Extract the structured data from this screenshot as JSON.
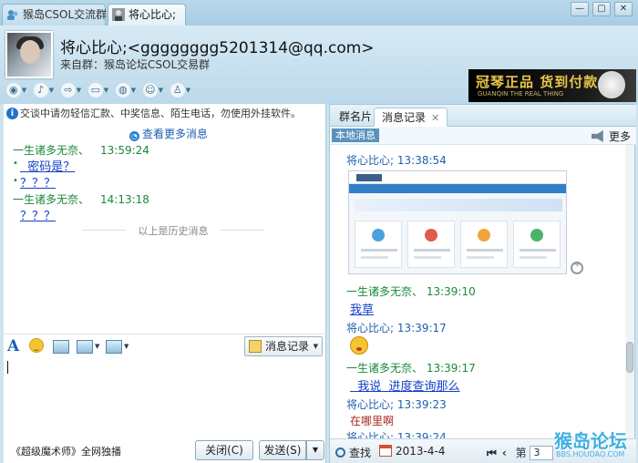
{
  "tabs": [
    {
      "label": "猴岛CSOL交流群",
      "active": false
    },
    {
      "label": "将心比心;",
      "active": true
    }
  ],
  "header": {
    "nick_email": "将心比心;<gggggggg5201314@qq.com>",
    "from_group": "来自群：猴岛论坛CSOL交易群",
    "ad_main": "冠琴正品 货到付款",
    "ad_sub": "GUANQIN THE REAL THING"
  },
  "left": {
    "notice": "交谈中请勿轻信汇款、中奖信息、陌生电话，勿使用外挂软件。",
    "more_link": "查看更多消息",
    "messages": [
      {
        "sender": "一生诸多无奈、",
        "time": "13:59:24",
        "body": "  密码是？"
      },
      {
        "body": "？？？"
      },
      {
        "sender": "一生诸多无奈、",
        "time": "14:13:18",
        "body": "？？？"
      }
    ],
    "history_divider": "以上是历史消息",
    "history_button": "消息记录",
    "promo": "《超级魔术师》全网独播",
    "close_button": "关闭(C)",
    "send_button": "发送(S)"
  },
  "right": {
    "tab_card": "群名片",
    "tab_history": "消息记录",
    "local_tag": "本地消息",
    "more": "更多",
    "messages": [
      {
        "sender": "将心比心;",
        "time": "13:38:54",
        "color": "blue"
      },
      {
        "sender": "一生诸多无奈、",
        "time": "13:39:10",
        "color": "green",
        "body": "我草"
      },
      {
        "sender": "将心比心;",
        "time": "13:39:17",
        "color": "blue"
      },
      {
        "sender": "一生诸多无奈、",
        "time": "13:39:17",
        "color": "green",
        "body": "  我说  进度查询那么"
      },
      {
        "sender": "将心比心;",
        "time": "13:39:23",
        "color": "blue",
        "body": "在哪里啊"
      },
      {
        "sender": "将心比心;",
        "time": "13:39:24",
        "color": "blue"
      }
    ],
    "find": "查找",
    "date": "2013-4-4",
    "page_label": "第",
    "page_value": "3"
  },
  "watermark": {
    "main": "猴岛论坛",
    "sub": "BBS.HOUDAO.COM"
  },
  "colors": {
    "accent": "#1d5fb0",
    "green": "#1a8a3a",
    "link": "#1540c8"
  }
}
